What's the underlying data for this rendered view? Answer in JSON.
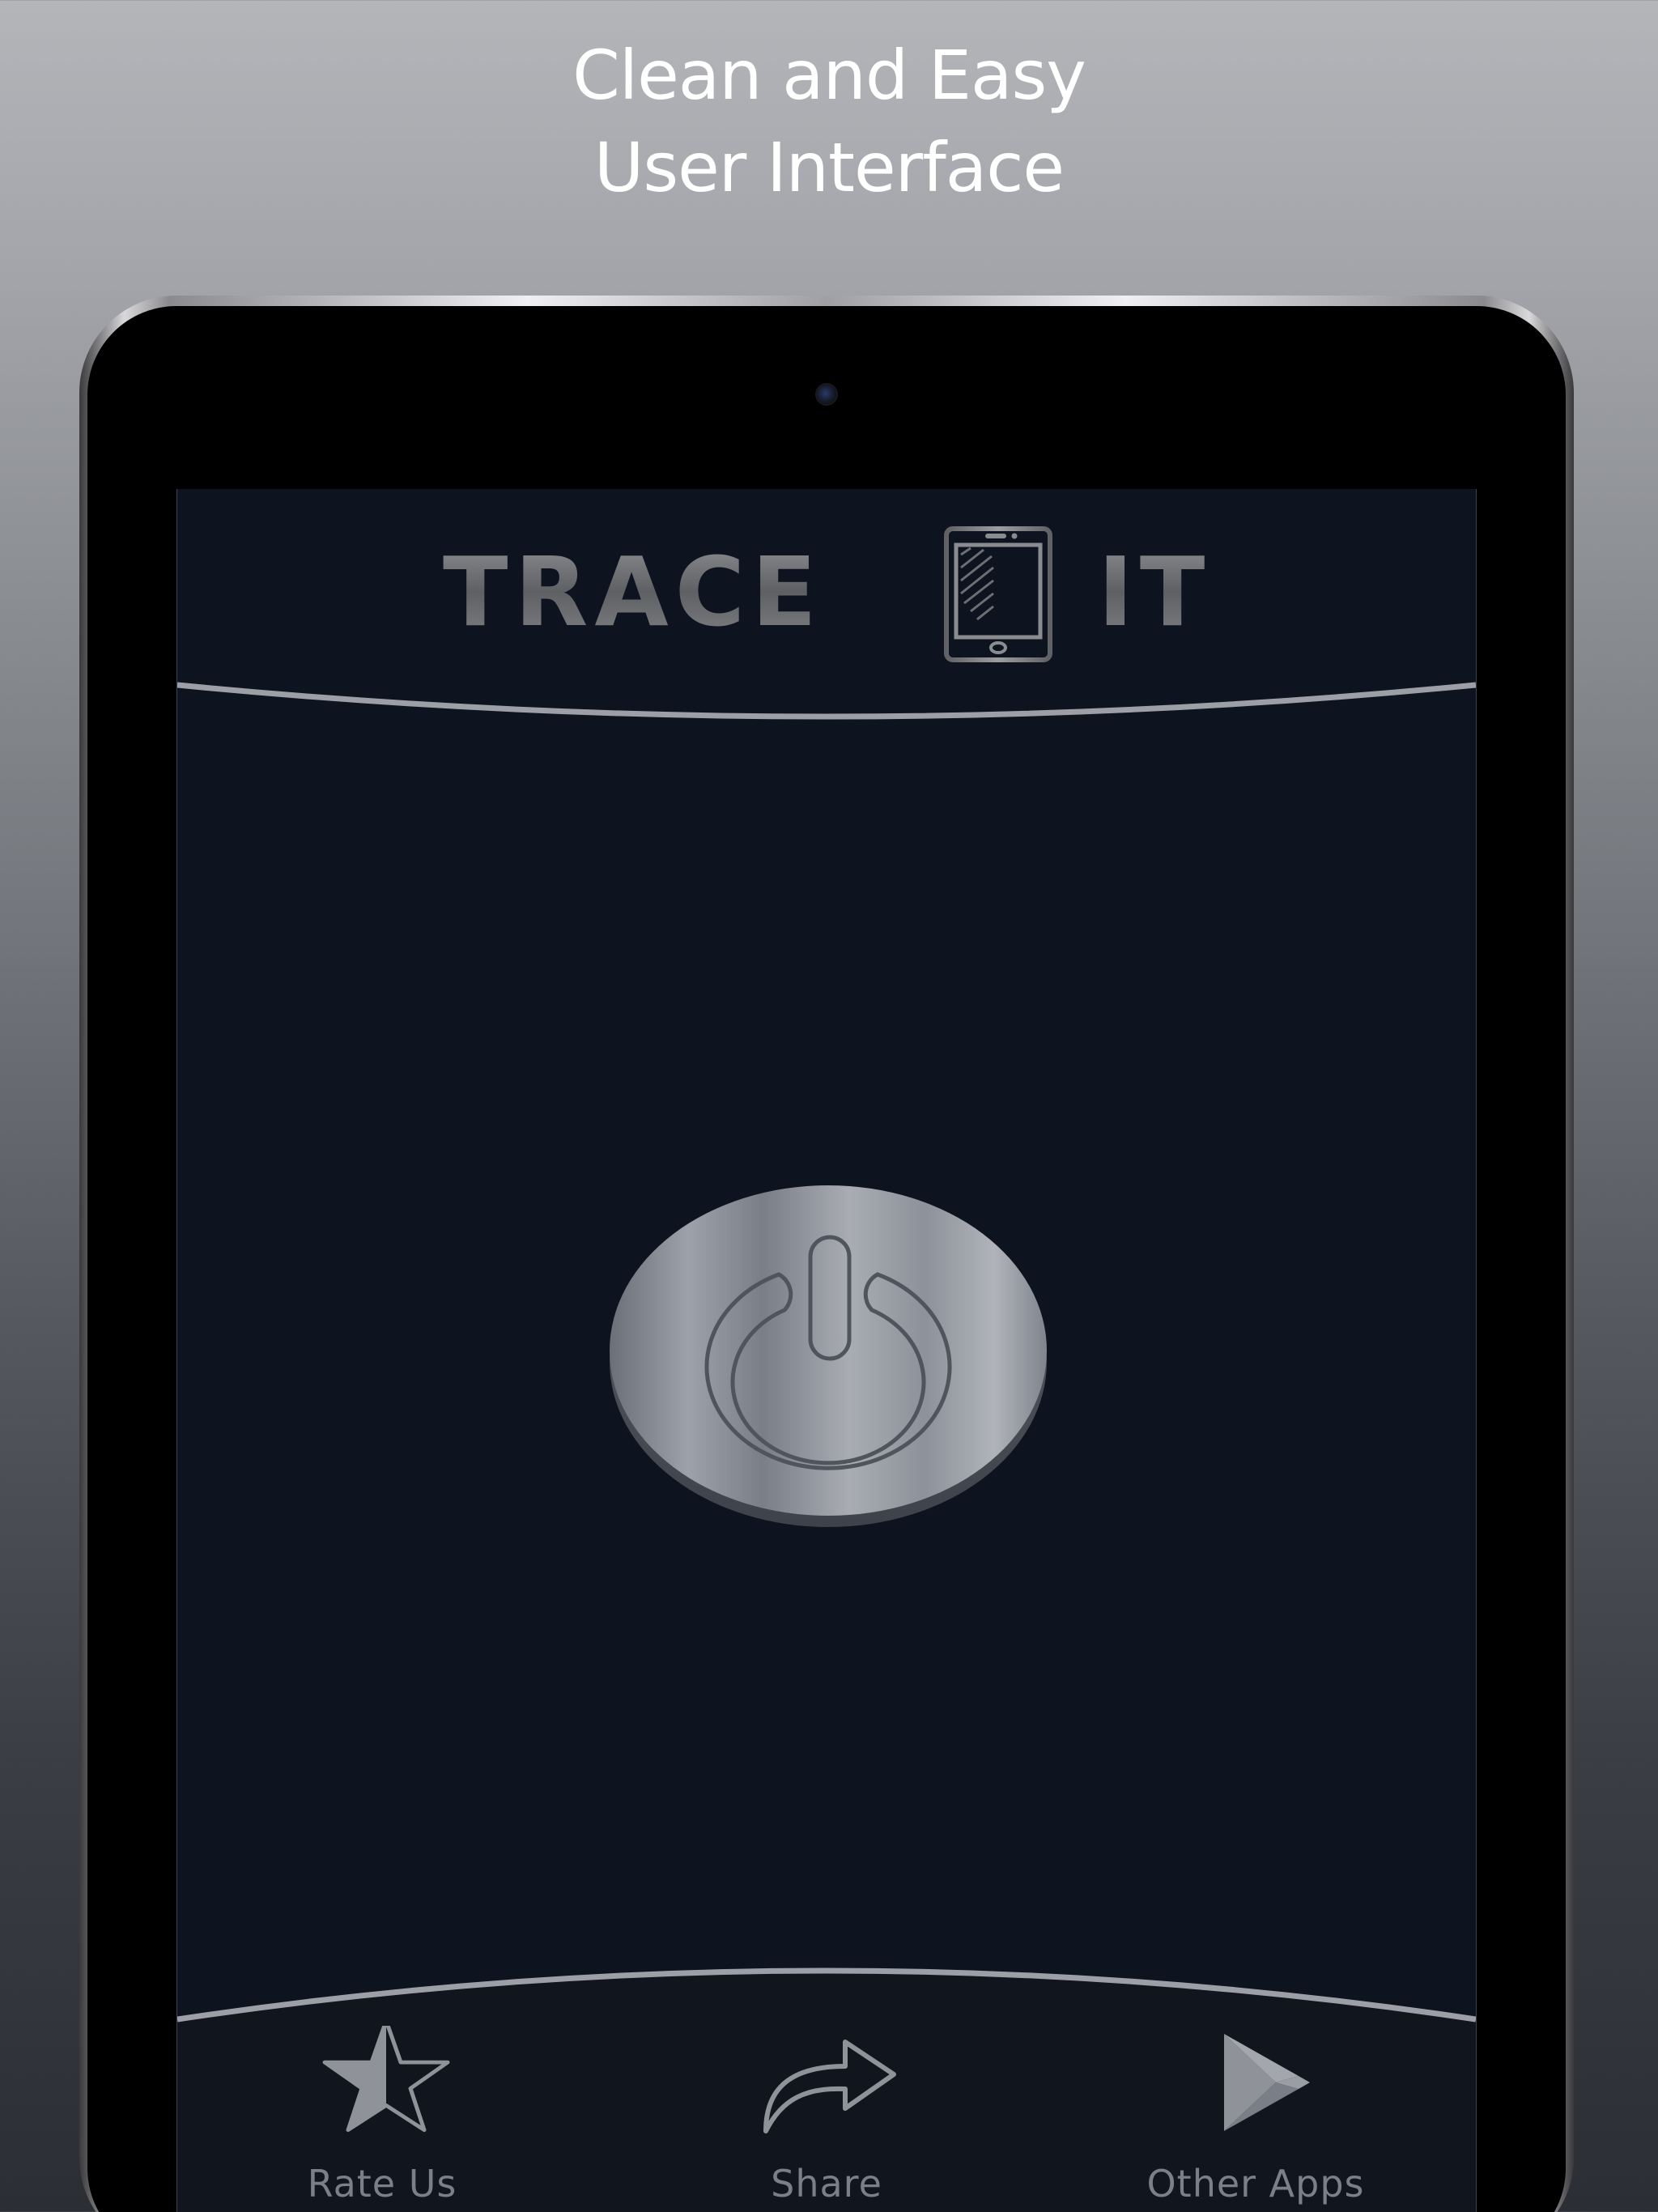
{
  "headline": {
    "line1": "Clean and Easy",
    "line2": "User Interface"
  },
  "app": {
    "logo_word_left": "TRACE",
    "logo_word_right": "IT",
    "logo_icon": "smartphone-icon",
    "power_icon": "power-icon",
    "state": "off"
  },
  "nav": {
    "items": [
      {
        "label": "Rate Us",
        "icon": "star-icon"
      },
      {
        "label": "Share",
        "icon": "share-arrow-icon"
      },
      {
        "label": "Other Apps",
        "icon": "play-store-icon"
      }
    ]
  },
  "colors": {
    "screen_background": "#0d141f",
    "divider": "#9c9fa6",
    "label": "#7b7f87",
    "headline_text": "#ffffff"
  }
}
